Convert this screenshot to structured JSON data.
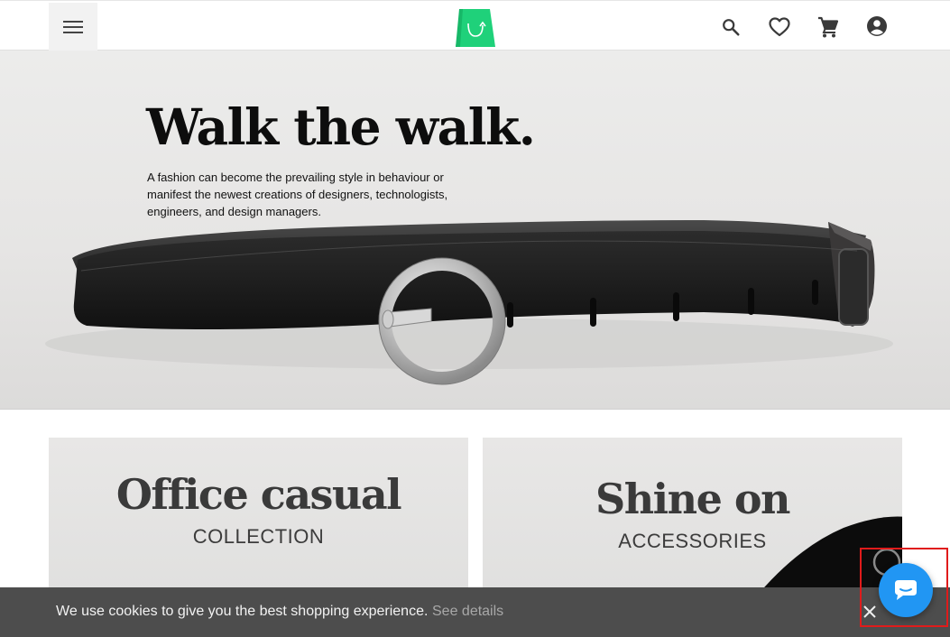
{
  "header": {
    "menu_icon": "hamburger-menu-icon",
    "logo_icon": "shopping-bag-logo-icon",
    "brand_color": "#1fd17a",
    "actions": [
      {
        "name": "search-icon"
      },
      {
        "name": "wishlist-heart-icon"
      },
      {
        "name": "cart-icon"
      },
      {
        "name": "account-icon"
      }
    ]
  },
  "hero": {
    "title": "Walk the walk.",
    "description": "A fashion can become the prevailing style in behaviour or manifest the newest creations of designers, technologists, engineers, and design managers."
  },
  "collections": [
    {
      "title": "Office casual",
      "subtitle": "COLLECTION"
    },
    {
      "title": "Shine on",
      "subtitle": "ACCESSORIES"
    }
  ],
  "cookie_bar": {
    "message": "We use cookies to give you the best shopping experience.",
    "link_label": "See details",
    "close_icon": "close-icon"
  },
  "chat": {
    "icon": "chat-bubble-icon",
    "color": "#2196f3",
    "highlight_color": "#e01b1b"
  }
}
